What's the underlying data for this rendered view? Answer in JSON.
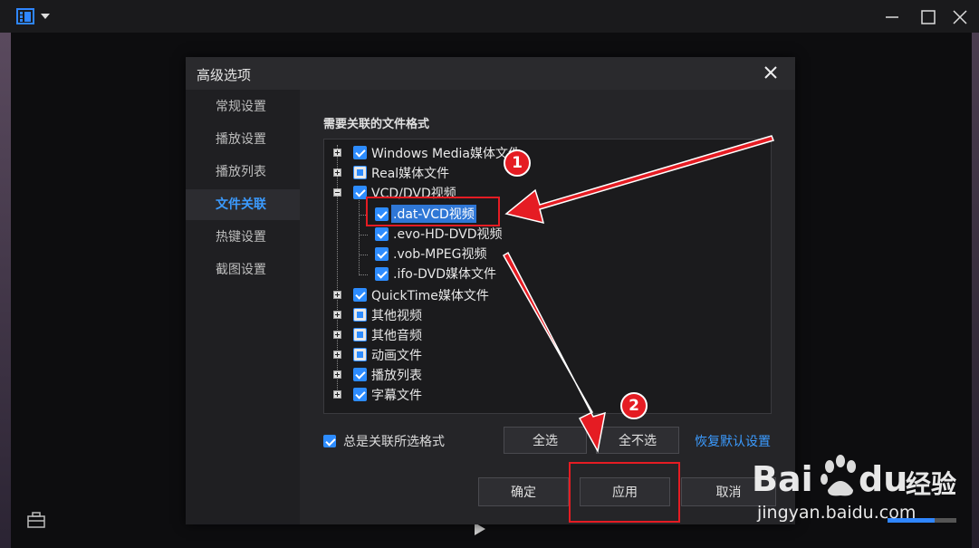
{
  "dialog": {
    "title": "高级选项",
    "nav": [
      "常规设置",
      "播放设置",
      "播放列表",
      "文件关联",
      "热键设置",
      "截图设置"
    ],
    "active_nav": "文件关联",
    "section_title": "需要关联的文件格式",
    "tree": {
      "windows_media": "Windows Media媒体文件",
      "real": "Real媒体文件",
      "vcd_dvd": "VCD/DVD视频",
      "dat": ".dat-VCD视频",
      "evo": ".evo-HD-DVD视频",
      "vob": ".vob-MPEG视频",
      "ifo": ".ifo-DVD媒体文件",
      "quicktime": "QuickTime媒体文件",
      "other_video": "其他视频",
      "other_audio": "其他音频",
      "animation": "动画文件",
      "playlist": "播放列表",
      "subtitle": "字幕文件"
    },
    "always_associate": "总是关联所选格式",
    "select_all": "全选",
    "deselect_all": "全不选",
    "restore_default": "恢复默认设置",
    "ok": "确定",
    "apply": "应用",
    "cancel": "取消"
  },
  "annotations": {
    "step1": "1",
    "step2": "2"
  },
  "watermark": {
    "brand_a": "Bai",
    "brand_b": "du",
    "brand_c": "经验",
    "url": "jingyan.baidu.com"
  },
  "colors": {
    "accent": "#2d8cff",
    "annotation": "#e51c23",
    "link": "#3b9bff"
  }
}
